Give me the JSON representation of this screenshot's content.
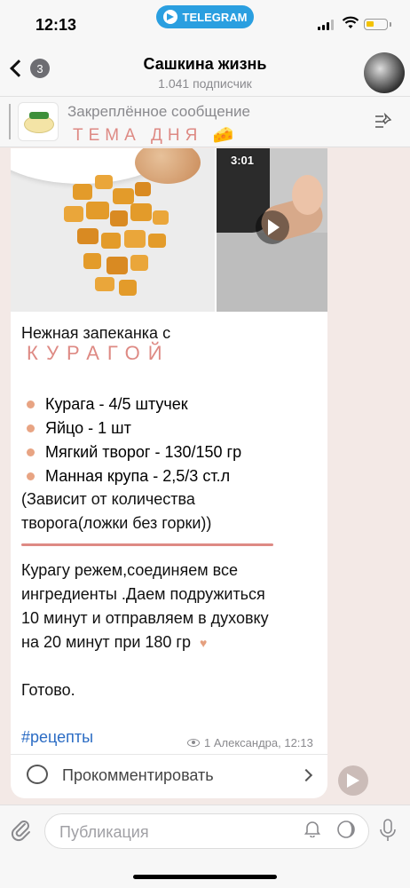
{
  "status_bar": {
    "time": "12:13",
    "app_pill": "TELEGRAM"
  },
  "header": {
    "back_count": "3",
    "title": "Сашкина жизнь",
    "subtitle": "1.041 подписчик"
  },
  "pinned": {
    "heading": "Закреплённое сообщение",
    "subheading": "ТЕМА ДНЯ",
    "emoji": "🧀"
  },
  "message": {
    "video_duration": "3:01",
    "title_line": "Нежная запеканка с",
    "title_spaced": "КУРАГОЙ",
    "ingredients": [
      "Курага - 4/5 штучек",
      "Яйцо - 1 шт",
      "Мягкий творог - 130/150 гр",
      "Манная крупа - 2,5/3 ст.л"
    ],
    "note_line1": "(Зависит от количества",
    "note_line2": "творога(ложки без горки))",
    "body_line1": "Курагу режем,соединяем все",
    "body_line2": "ингредиенты .Даем подружиться",
    "body_line3": "10 минут и отправляем в духовку",
    "body_line4": "на 20 минут при 180 гр",
    "heart": "♥",
    "done": "Готово.",
    "hashtag": "#рецепты",
    "views_meta": "1 Александра, 12:13",
    "comment_label": "Прокомментировать"
  },
  "composer": {
    "placeholder": "Публикация"
  },
  "colors": {
    "accent_pink": "#de8a84",
    "telegram_blue": "#2a9fe0",
    "link_blue": "#2b6cc4"
  },
  "icons": [
    "back-chevron-icon",
    "pin-list-icon",
    "play-icon",
    "eye-icon",
    "comment-icon",
    "chevron-right-icon",
    "share-icon",
    "paperclip-icon",
    "bell-icon",
    "moon-icon",
    "mic-icon"
  ]
}
